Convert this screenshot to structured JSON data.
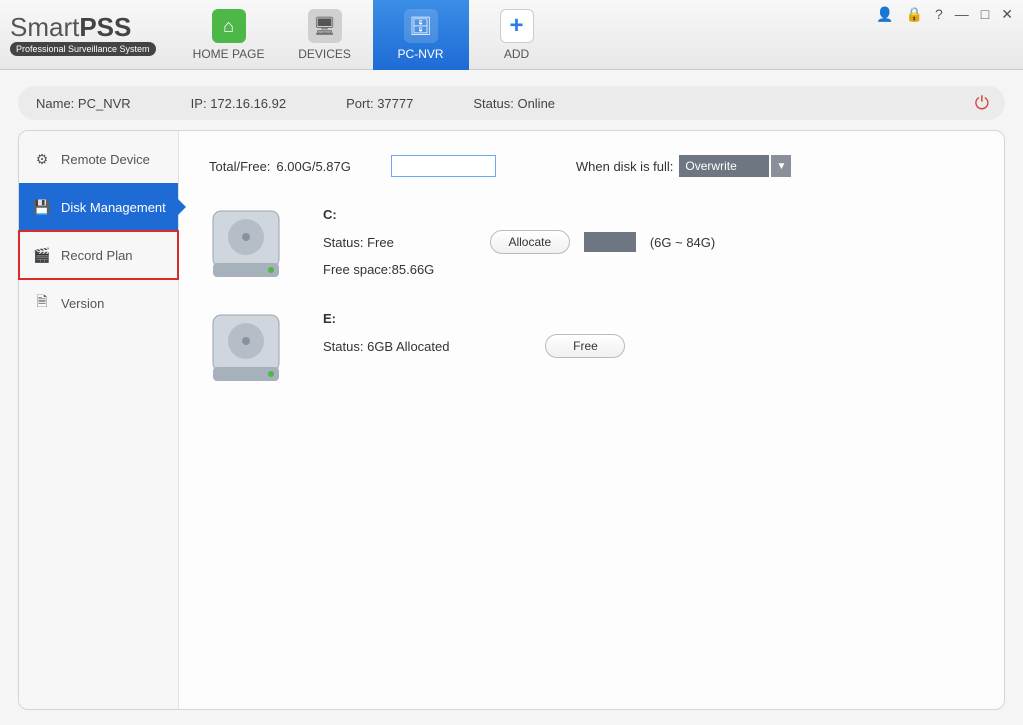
{
  "app": {
    "name": "SmartPSS",
    "tagline": "Professional Surveillance System"
  },
  "tabs": {
    "home": "HOME PAGE",
    "devices": "DEVICES",
    "pcnvr": "PC-NVR",
    "add": "ADD"
  },
  "status": {
    "name_label": "Name:",
    "name_value": "PC_NVR",
    "ip_label": "IP:",
    "ip_value": "172.16.16.92",
    "port_label": "Port:",
    "port_value": "37777",
    "status_label": "Status:",
    "status_value": "Online"
  },
  "sidebar": {
    "remote_device": "Remote Device",
    "disk_management": "Disk Management",
    "record_plan": "Record Plan",
    "version": "Version"
  },
  "disk_mgmt": {
    "total_free_label": "Total/Free:",
    "total_free_value": "6.00G/5.87G",
    "disk_full_label": "When disk is full:",
    "disk_full_option": "Overwrite",
    "drives": {
      "c": {
        "letter": "C:",
        "status_label": "Status:",
        "status_value": "Free",
        "free_space": "Free space:85.66G",
        "action": "Allocate",
        "range": "(6G ~ 84G)"
      },
      "e": {
        "letter": "E:",
        "status_label": "Status:",
        "status_value": "6GB Allocated",
        "action": "Free"
      }
    }
  }
}
